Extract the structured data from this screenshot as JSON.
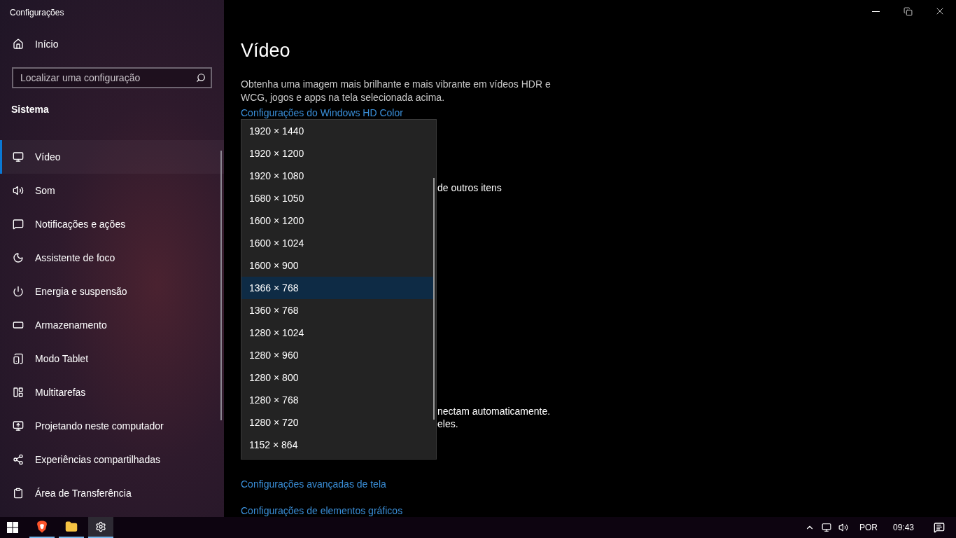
{
  "window": {
    "title": "Configurações"
  },
  "sidebar": {
    "home": "Início",
    "search": {
      "placeholder": "Localizar uma configuração"
    },
    "section": "Sistema",
    "items": [
      {
        "label": "Vídeo",
        "selected": true
      },
      {
        "label": "Som",
        "selected": false
      },
      {
        "label": "Notificações e ações",
        "selected": false
      },
      {
        "label": "Assistente de foco",
        "selected": false
      },
      {
        "label": "Energia e suspensão",
        "selected": false
      },
      {
        "label": "Armazenamento",
        "selected": false
      },
      {
        "label": "Modo Tablet",
        "selected": false
      },
      {
        "label": "Multitarefas",
        "selected": false
      },
      {
        "label": "Projetando neste computador",
        "selected": false
      },
      {
        "label": "Experiências compartilhadas",
        "selected": false
      },
      {
        "label": "Área de Transferência",
        "selected": false
      }
    ]
  },
  "content": {
    "title": "Vídeo",
    "description": "Obtenha uma imagem mais brilhante e mais vibrante em vídeos HDR e WCG, jogos e apps na tela selecionada acima.",
    "hd_link": "Configurações do Windows HD Color",
    "covered_text_1": "de outros itens",
    "covered_text_2": [
      "nectam automaticamente.",
      "eles."
    ],
    "links": [
      "Configurações avançadas de tela",
      "Configurações de elementos gráficos"
    ]
  },
  "resolution_dropdown": {
    "options": [
      {
        "label": "1920 × 1440",
        "selected": false
      },
      {
        "label": "1920 × 1200",
        "selected": false
      },
      {
        "label": "1920 × 1080",
        "selected": false
      },
      {
        "label": "1680 × 1050",
        "selected": false
      },
      {
        "label": "1600 × 1200",
        "selected": false
      },
      {
        "label": "1600 × 1024",
        "selected": false
      },
      {
        "label": "1600 × 900",
        "selected": false
      },
      {
        "label": "1366 × 768",
        "selected": true
      },
      {
        "label": "1360 × 768",
        "selected": false
      },
      {
        "label": "1280 × 1024",
        "selected": false
      },
      {
        "label": "1280 × 960",
        "selected": false
      },
      {
        "label": "1280 × 800",
        "selected": false
      },
      {
        "label": "1280 × 768",
        "selected": false
      },
      {
        "label": "1280 × 720",
        "selected": false
      },
      {
        "label": "1152 × 864",
        "selected": false
      }
    ]
  },
  "taskbar": {
    "apps": [
      {
        "selected": false
      },
      {
        "selected": false
      },
      {
        "selected": true
      }
    ],
    "language": "POR",
    "time": "09:43"
  }
}
